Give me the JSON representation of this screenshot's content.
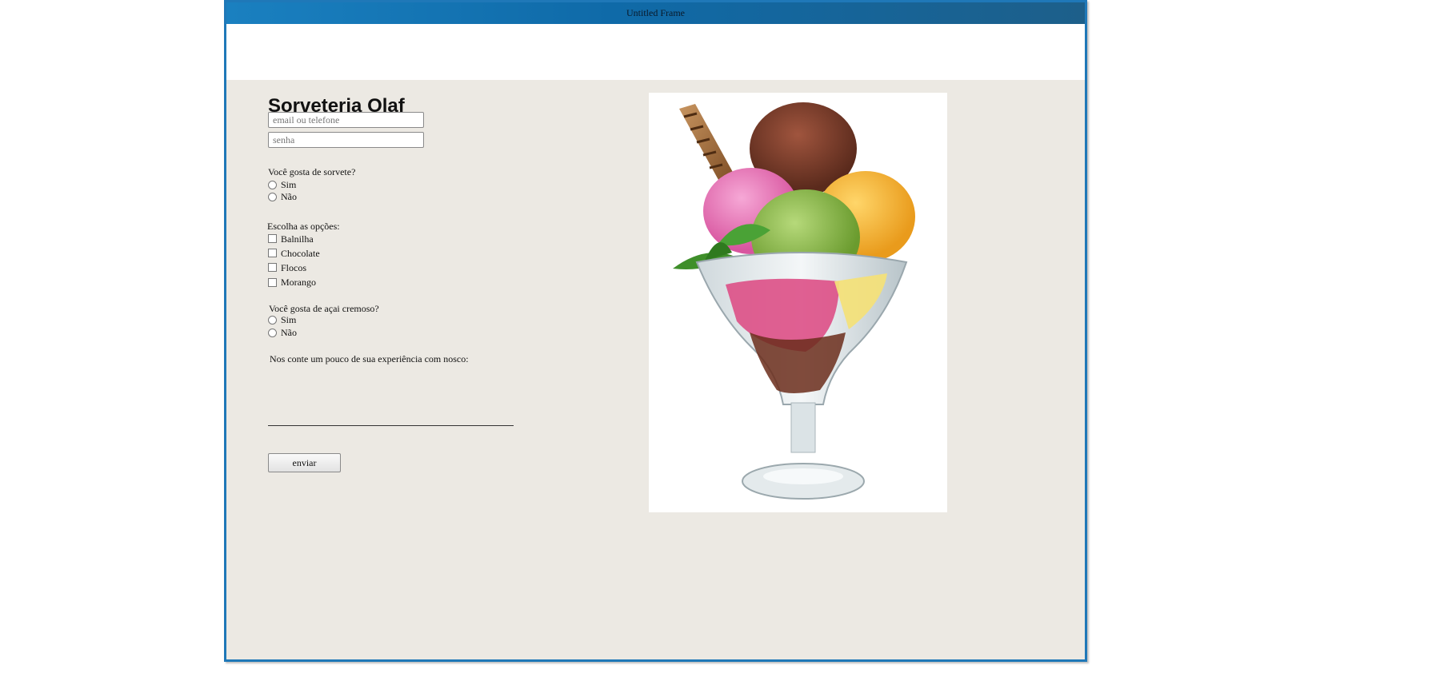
{
  "window": {
    "title": "Untitled Frame"
  },
  "form": {
    "heading": "Sorveteria Olaf",
    "email_placeholder": "email ou telefone",
    "password_placeholder": "senha",
    "q1": {
      "label": "Você gosta de sorvete?",
      "options": [
        "Sim",
        "Não"
      ]
    },
    "q2": {
      "label": "Escolha as opções:",
      "options": [
        "Balnilha",
        "Chocolate",
        "Flocos",
        "Morango"
      ]
    },
    "q3": {
      "label": "Você gosta de açai cremoso?",
      "options": [
        "Sim",
        "Não"
      ]
    },
    "experience_label": "Nos conte um pouco de sua experiência com nosco:",
    "submit_label": "enviar"
  },
  "image": {
    "subject": "ice-cream-sundae"
  },
  "colors": {
    "frame_border": "#1f78b8",
    "titlebar": "#1a80c0",
    "content_bg": "#ece9e3"
  }
}
